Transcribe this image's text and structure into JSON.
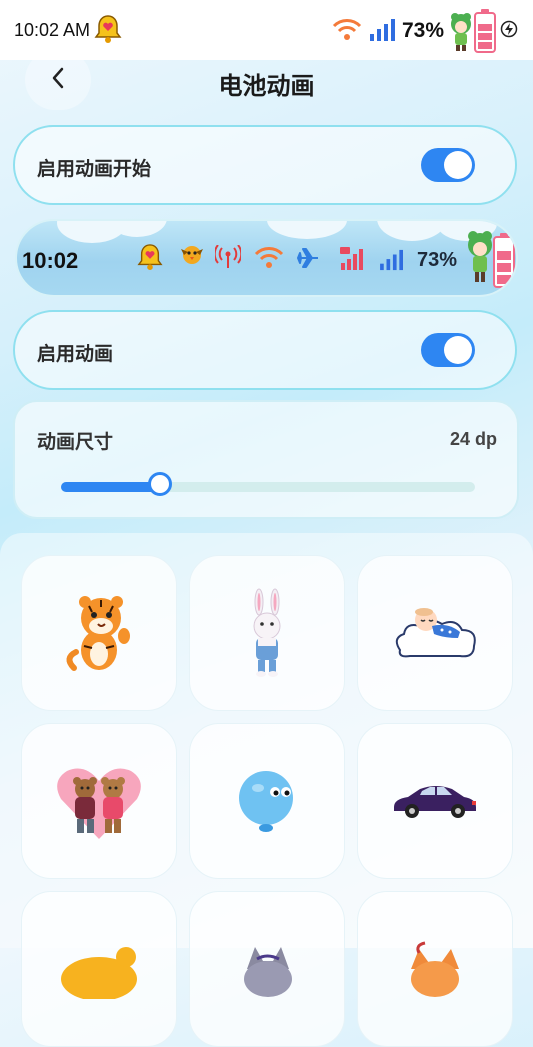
{
  "status_bar": {
    "time": "10:02 AM",
    "battery_percent": "73%",
    "icons": [
      "bell-heart-icon",
      "wifi-icon",
      "signal-icon",
      "character-battery-icon",
      "charging-icon"
    ]
  },
  "header": {
    "title": "电池动画",
    "back_icon": "chevron-left-icon"
  },
  "settings": {
    "enable_start_label": "启用动画开始",
    "enable_start_on": true,
    "enable_anim_label": "启用动画",
    "enable_anim_on": true
  },
  "preview": {
    "time": "10:02",
    "battery_percent": "73%",
    "icons": [
      "bell-heart-icon",
      "bird-icon",
      "hotspot-icon",
      "wifi-icon",
      "airplane-icon",
      "signal-4g-icon",
      "signal-icon",
      "character-battery-icon"
    ]
  },
  "size_setting": {
    "label": "动画尺寸",
    "value_text": "24 dp",
    "level": 0.24
  },
  "animations": [
    {
      "name": "tiger"
    },
    {
      "name": "bunny"
    },
    {
      "name": "baby-on-cloud"
    },
    {
      "name": "bear-couple"
    },
    {
      "name": "blue-balloon"
    },
    {
      "name": "car"
    },
    {
      "name": "orange-creature"
    },
    {
      "name": "cat"
    },
    {
      "name": "fox"
    }
  ],
  "colors": {
    "accent": "#2e86f2",
    "card_border": "#8fe0ef"
  }
}
